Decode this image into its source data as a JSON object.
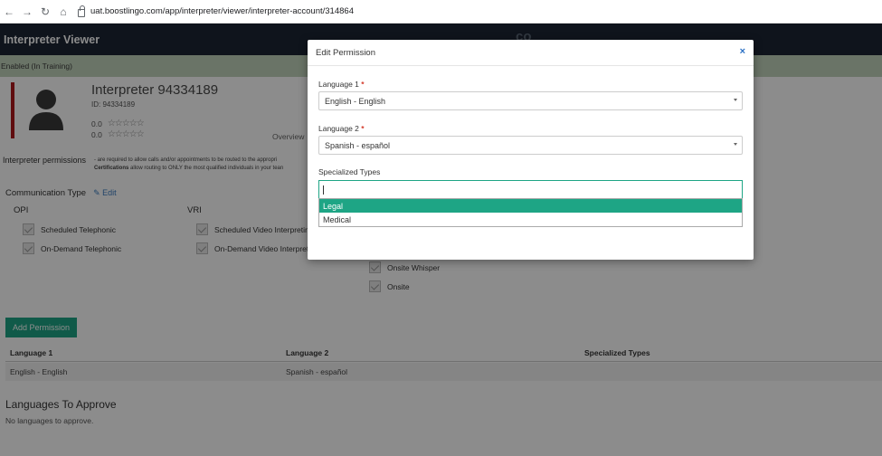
{
  "browser": {
    "url": "uat.boostlingo.com/app/interpreter/viewer/interpreter-account/314864"
  },
  "app": {
    "title": "Interpreter Viewer",
    "logo": "co"
  },
  "status": "Enabled (In Training)",
  "profile": {
    "name": "Interpreter 94334189",
    "id_label": "ID: 94334189",
    "rating1": "0.0",
    "rating2": "0.0",
    "stars": "☆☆☆☆☆",
    "overview_tab": "Overview"
  },
  "permissions": {
    "title": "Interpreter permissions",
    "desc_line1": "- are required to allow calls and/or appointments to be routed to the appropri",
    "desc_bold": "Certifications",
    "desc_line2": " allow routing to ONLY the most qualified individuals in your tean"
  },
  "communication": {
    "title": "Communication Type",
    "edit_label": "Edit",
    "opi_head": "OPI",
    "vri_head": "VRI",
    "opi_items": [
      "Scheduled Telephonic",
      "On-Demand Telephonic"
    ],
    "vri_items": [
      "Scheduled Video Interpreting",
      "On-Demand Video Interpreti"
    ],
    "onsite_items": [
      "Onsite Whisper",
      "Onsite"
    ]
  },
  "add_permission_label": "Add Permission",
  "table": {
    "headers": [
      "Language 1",
      "Language 2",
      "Specialized Types"
    ],
    "rows": [
      [
        "English - English",
        "Spanish - español",
        ""
      ]
    ]
  },
  "languages_to_approve": {
    "title": "Languages To Approve",
    "empty": "No languages to approve."
  },
  "modal": {
    "title": "Edit Permission",
    "close": "×",
    "language1_label": "Language 1",
    "language1_value": "English - English",
    "language2_label": "Language 2",
    "language2_value": "Spanish - español",
    "required_mark": "*",
    "specialized_label": "Specialized Types",
    "options": [
      "Legal",
      "Medical"
    ]
  },
  "colors": {
    "accent": "#1ea585",
    "header": "#1c2634",
    "status_bg": "#c2d3bc",
    "required": "#d43c2d",
    "profile_bar": "#b0191c"
  }
}
